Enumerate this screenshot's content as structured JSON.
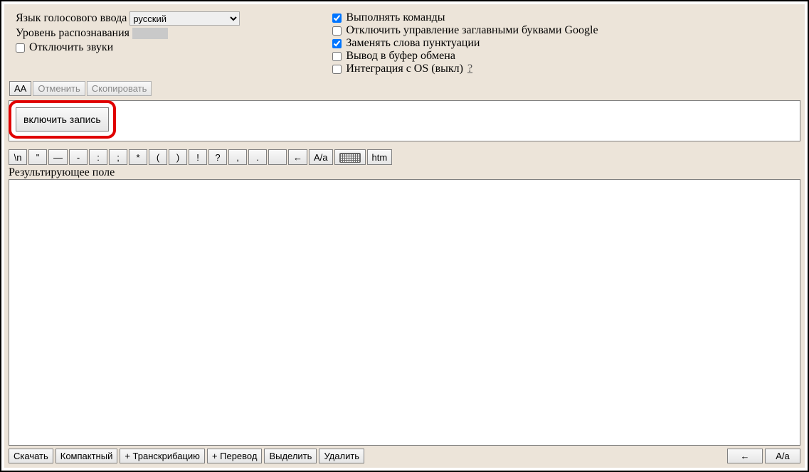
{
  "settings": {
    "language_label": "Язык голосового ввода",
    "language_value": "русский",
    "recognition_level_label": "Уровень распознавания",
    "disable_sounds": {
      "label": "Отключить звуки",
      "checked": false
    },
    "execute_commands": {
      "label": "Выполнять команды",
      "checked": true
    },
    "disable_caps_google": {
      "label": "Отключить управление заглавными буквами Google",
      "checked": false
    },
    "replace_punctuation_words": {
      "label": "Заменять слова пунктуации",
      "checked": true
    },
    "output_to_clipboard": {
      "label": "Вывод в буфер обмена",
      "checked": false
    },
    "os_integration": {
      "label": "Интеграция с OS (выкл)",
      "checked": false,
      "help": "?"
    }
  },
  "toolbar1": {
    "aa": "AA",
    "undo": "Отменить",
    "copy": "Скопировать"
  },
  "record_button": "включить запись",
  "input_value": "",
  "symbols": {
    "newline": "\\n",
    "quote": "\"",
    "mdash": "—",
    "dash": "-",
    "colon": ":",
    "semicolon": ";",
    "asterisk": "*",
    "lparen": "(",
    "rparen": ")",
    "exclaim": "!",
    "question": "?",
    "comma": ",",
    "period": ".",
    "blank": " ",
    "arrow_left": "←",
    "case_toggle": "A/a",
    "htm": "htm"
  },
  "result_label": "Результирующее поле",
  "result_value": "",
  "bottom": {
    "download": "Скачать",
    "compact": "Компактный",
    "add_transcribe": "+ Транскрибацию",
    "add_translate": "+ Перевод",
    "select": "Выделить",
    "delete": "Удалить",
    "arrow_left": "←",
    "case_toggle": "A/a"
  }
}
